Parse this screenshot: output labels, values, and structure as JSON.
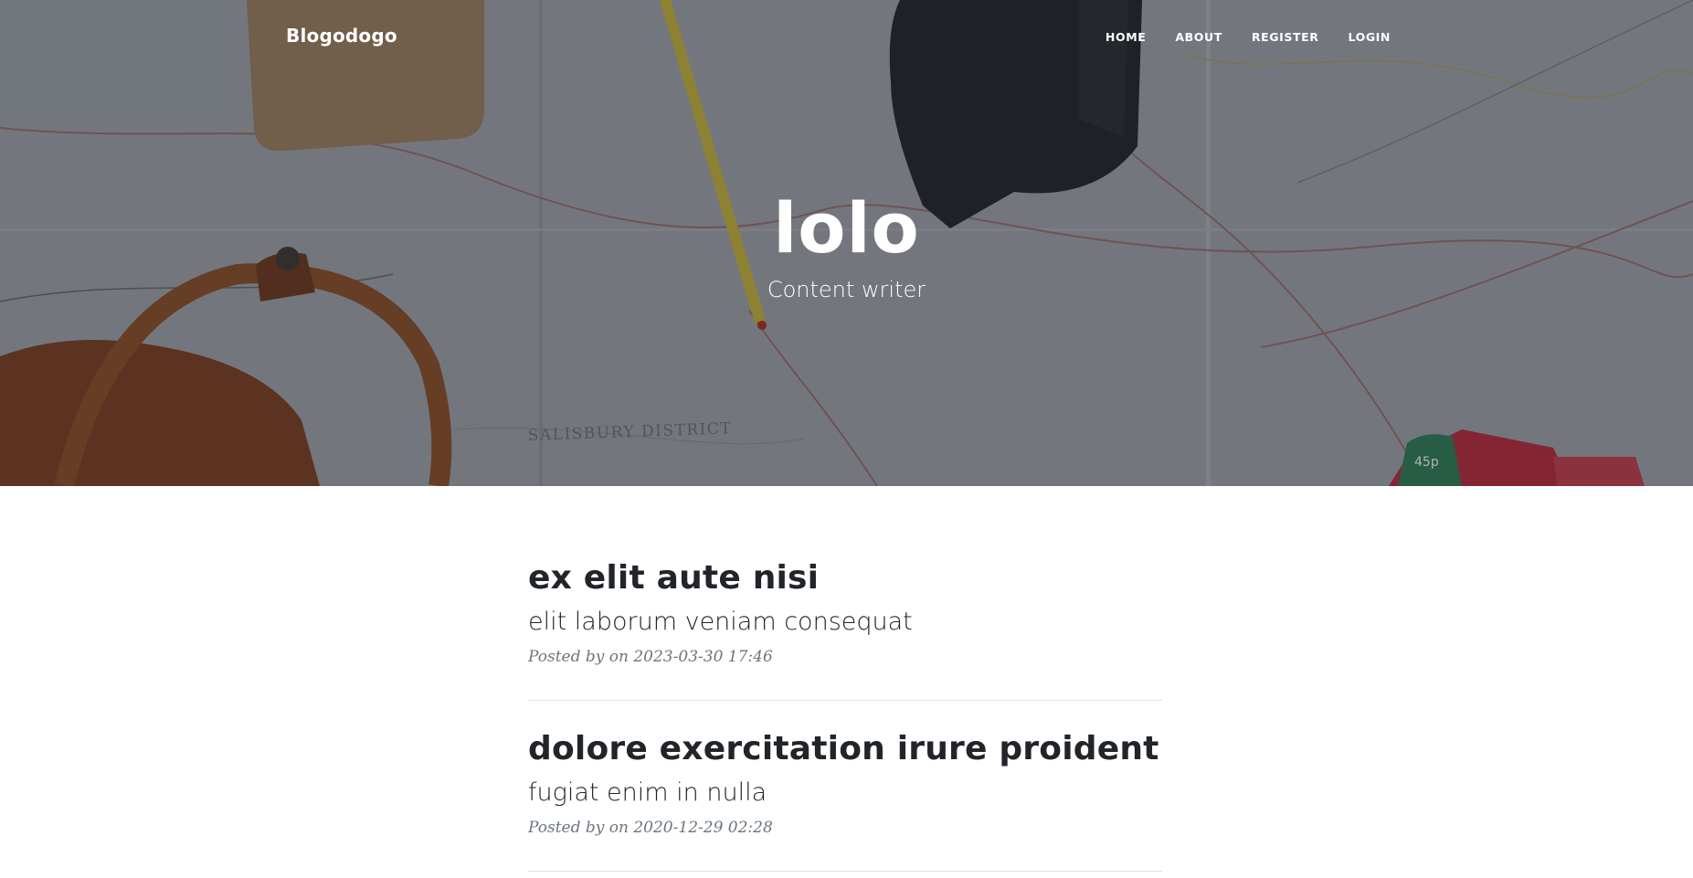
{
  "navbar": {
    "brand": "Blogodogo",
    "links": [
      {
        "label": "HOME"
      },
      {
        "label": "ABOUT"
      },
      {
        "label": "REGISTER"
      },
      {
        "label": "LOGIN"
      }
    ]
  },
  "header": {
    "title": "lolo",
    "subtitle": "Content writer",
    "background_map_label": "SALISBURY DISTRICT",
    "stamp_label": "45p"
  },
  "posts": [
    {
      "title": "ex elit aute nisi",
      "subtitle": "elit laborum veniam consequat",
      "meta": "Posted by on 2023-03-30 17:46"
    },
    {
      "title": "dolore exercitation irure proident",
      "subtitle": "fugiat enim in nulla",
      "meta": "Posted by on 2020-12-29 02:28"
    }
  ],
  "colors": {
    "text_dark": "#212529",
    "text_muted": "#6c757d",
    "divider": "#dee2e6",
    "overlay": "rgba(33,37,41,0.35)"
  }
}
